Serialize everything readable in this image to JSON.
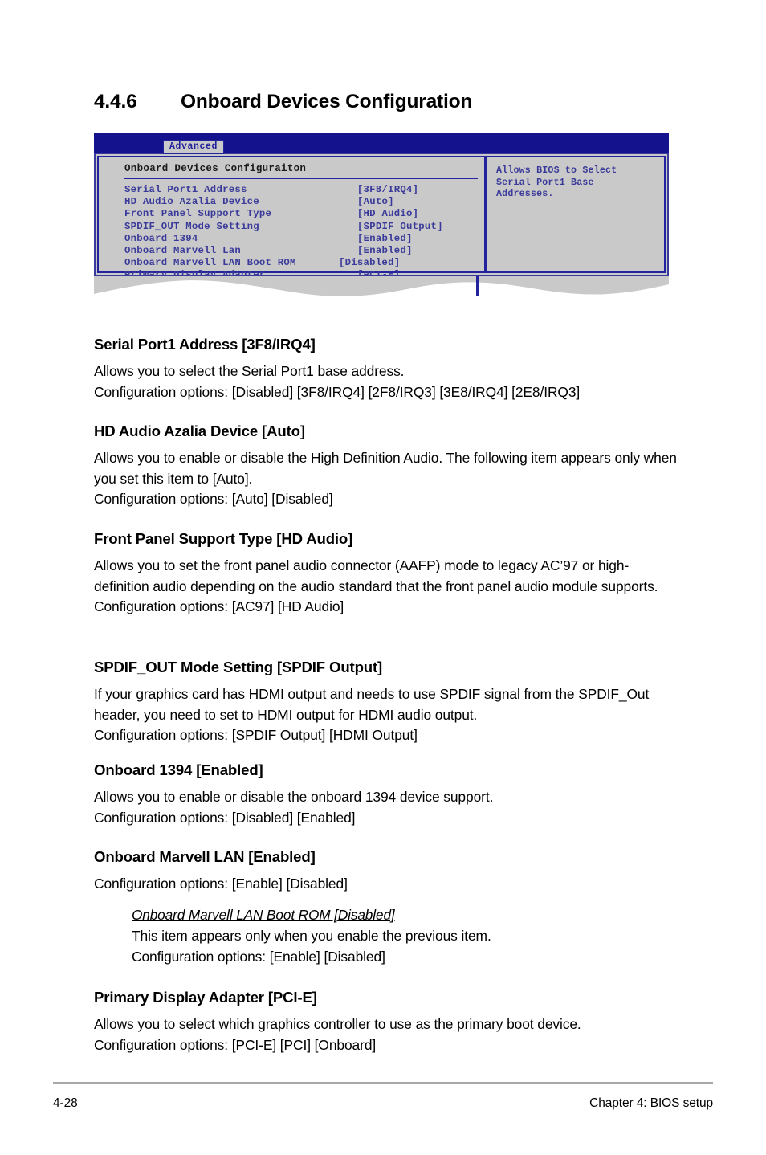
{
  "colors": {
    "bios_topbar": "#14128c",
    "bios_panel_bg": "#c9c9c9",
    "bios_text": "#3a3a9a",
    "bios_border": "#23239e",
    "footer_rule": "#a8a8a8"
  },
  "section": {
    "number": "4.4.6",
    "title": "Onboard Devices Configuration"
  },
  "bios_screen": {
    "tab_label": "Advanced",
    "panel_title": "Onboard Devices Configuraiton",
    "rows": [
      {
        "label": "Serial Port1 Address",
        "value": "[3F8/IRQ4]",
        "indent": 0
      },
      {
        "label": "HD Audio Azalia Device",
        "value": "[Auto]",
        "indent": 0
      },
      {
        "label": "Front Panel Support Type",
        "value": "[HD Audio]",
        "indent": 0
      },
      {
        "label": "SPDIF_OUT Mode Setting",
        "value": "[SPDIF Output]",
        "indent": 0
      },
      {
        "label": "Onboard 1394",
        "value": "[Enabled]",
        "indent": 0
      },
      {
        "label": "Onboard Marvell Lan",
        "value": "[Enabled]",
        "indent": 0
      },
      {
        "label": "Onboard Marvell LAN Boot ROM",
        "value": "[Disabled]",
        "indent": 1
      },
      {
        "label": "Primary Display Adapter",
        "value": "[PCI-E]",
        "indent": 0
      }
    ],
    "help_text": "Allows BIOS to Select\nSerial Port1 Base\nAddresses."
  },
  "body_sections": [
    {
      "heading": "Serial Port1 Address [3F8/IRQ4]",
      "paragraphs": [
        "Allows you to select the Serial Port1 base address.",
        "Configuration options: [Disabled] [3F8/IRQ4] [2F8/IRQ3] [3E8/IRQ4] [2E8/IRQ3]"
      ]
    },
    {
      "heading": "HD Audio Azalia Device [Auto]",
      "paragraphs": [
        "Allows you to enable or disable the High Definition Audio. The following item appears only when you set this item to [Auto].",
        "Configuration options: [Auto] [Disabled]"
      ]
    },
    {
      "heading": "Front Panel Support Type [HD Audio]",
      "paragraphs": [
        "Allows you to set the front panel audio connector (AAFP) mode to legacy AC’97 or high-definition audio depending on the audio standard that the front panel audio module supports.",
        "Configuration options: [AC97] [HD Audio]"
      ]
    },
    {
      "heading": "SPDIF_OUT Mode Setting [SPDIF Output]",
      "paragraphs": [
        "If your graphics card has HDMI output and needs to use SPDIF signal from the SPDIF_Out header, you need to set to HDMI output for HDMI audio output.",
        "Configuration options: [SPDIF Output] [HDMI Output]"
      ]
    },
    {
      "heading": "Onboard 1394 [Enabled]",
      "paragraphs": [
        "Allows you to enable or disable the onboard 1394 device support.",
        "Configuration options: [Disabled] [Enabled]"
      ]
    },
    {
      "heading": "Onboard Marvell LAN [Enabled]",
      "paragraphs": [
        "Configuration options: [Enable] [Disabled]"
      ]
    },
    {
      "heading": "Primary Display Adapter [PCI-E]",
      "paragraphs": [
        "Allows you to select which graphics controller to use as the primary boot device.",
        "Configuration options: [PCI-E] [PCI] [Onboard]"
      ]
    }
  ],
  "sub_section": {
    "heading": "Onboard Marvell LAN Boot ROM [Disabled]",
    "paragraphs": [
      "This item appears only when you enable the previous item.",
      "Configuration options: [Enable] [Disabled]"
    ]
  },
  "footer": {
    "page_number": "4-28",
    "chapter": "Chapter 4: BIOS setup"
  }
}
